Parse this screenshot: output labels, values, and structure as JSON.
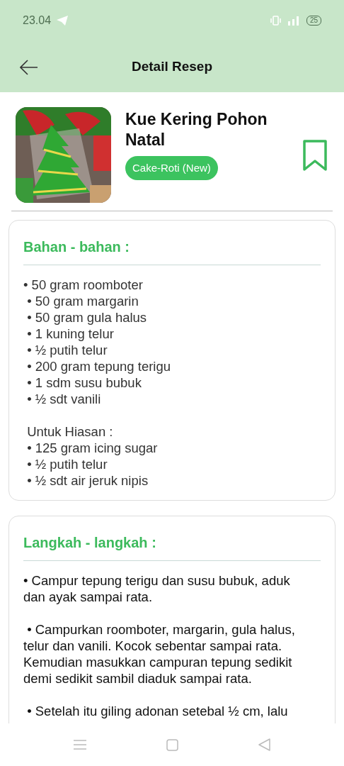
{
  "status_bar": {
    "time": "23.04",
    "battery": "25"
  },
  "app_bar": {
    "title": "Detail Resep"
  },
  "recipe": {
    "title": "Kue Kering Pohon Natal",
    "category": "Cake-Roti (New)",
    "bookmarked": false
  },
  "ingredients": {
    "heading": "Bahan - bahan :",
    "lines": [
      {
        "kind": "item",
        "text": "• 50 gram roomboter"
      },
      {
        "kind": "item",
        "text": " • 50 gram margarin"
      },
      {
        "kind": "item",
        "text": " • 50 gram gula halus"
      },
      {
        "kind": "item",
        "text": " • 1 kuning telur"
      },
      {
        "kind": "item",
        "text": " • ½ putih telur"
      },
      {
        "kind": "item",
        "text": " • 200 gram tepung terigu"
      },
      {
        "kind": "item",
        "text": " • 1 sdm susu bubuk"
      },
      {
        "kind": "item",
        "text": " • ½ sdt vanili"
      },
      {
        "kind": "gap"
      },
      {
        "kind": "item",
        "text": " Untuk Hiasan :"
      },
      {
        "kind": "item",
        "text": " • 125 gram icing sugar"
      },
      {
        "kind": "item",
        "text": " • ½ putih telur"
      },
      {
        "kind": "item",
        "text": " • ½ sdt air jeruk nipis"
      }
    ]
  },
  "steps": {
    "heading": "Langkah - langkah :",
    "paragraphs": [
      "• Campur tepung terigu dan susu bubuk, aduk dan ayak sampai rata.",
      " • Campurkan roomboter, margarin, gula halus, telur dan vanili. Kocok sebentar sampai rata. Kemudian masukkan campuran tepung sedikit demi sedikit sambil diaduk sampai rata.",
      " • Setelah itu giling adonan setebal ½ cm, lalu"
    ]
  }
}
